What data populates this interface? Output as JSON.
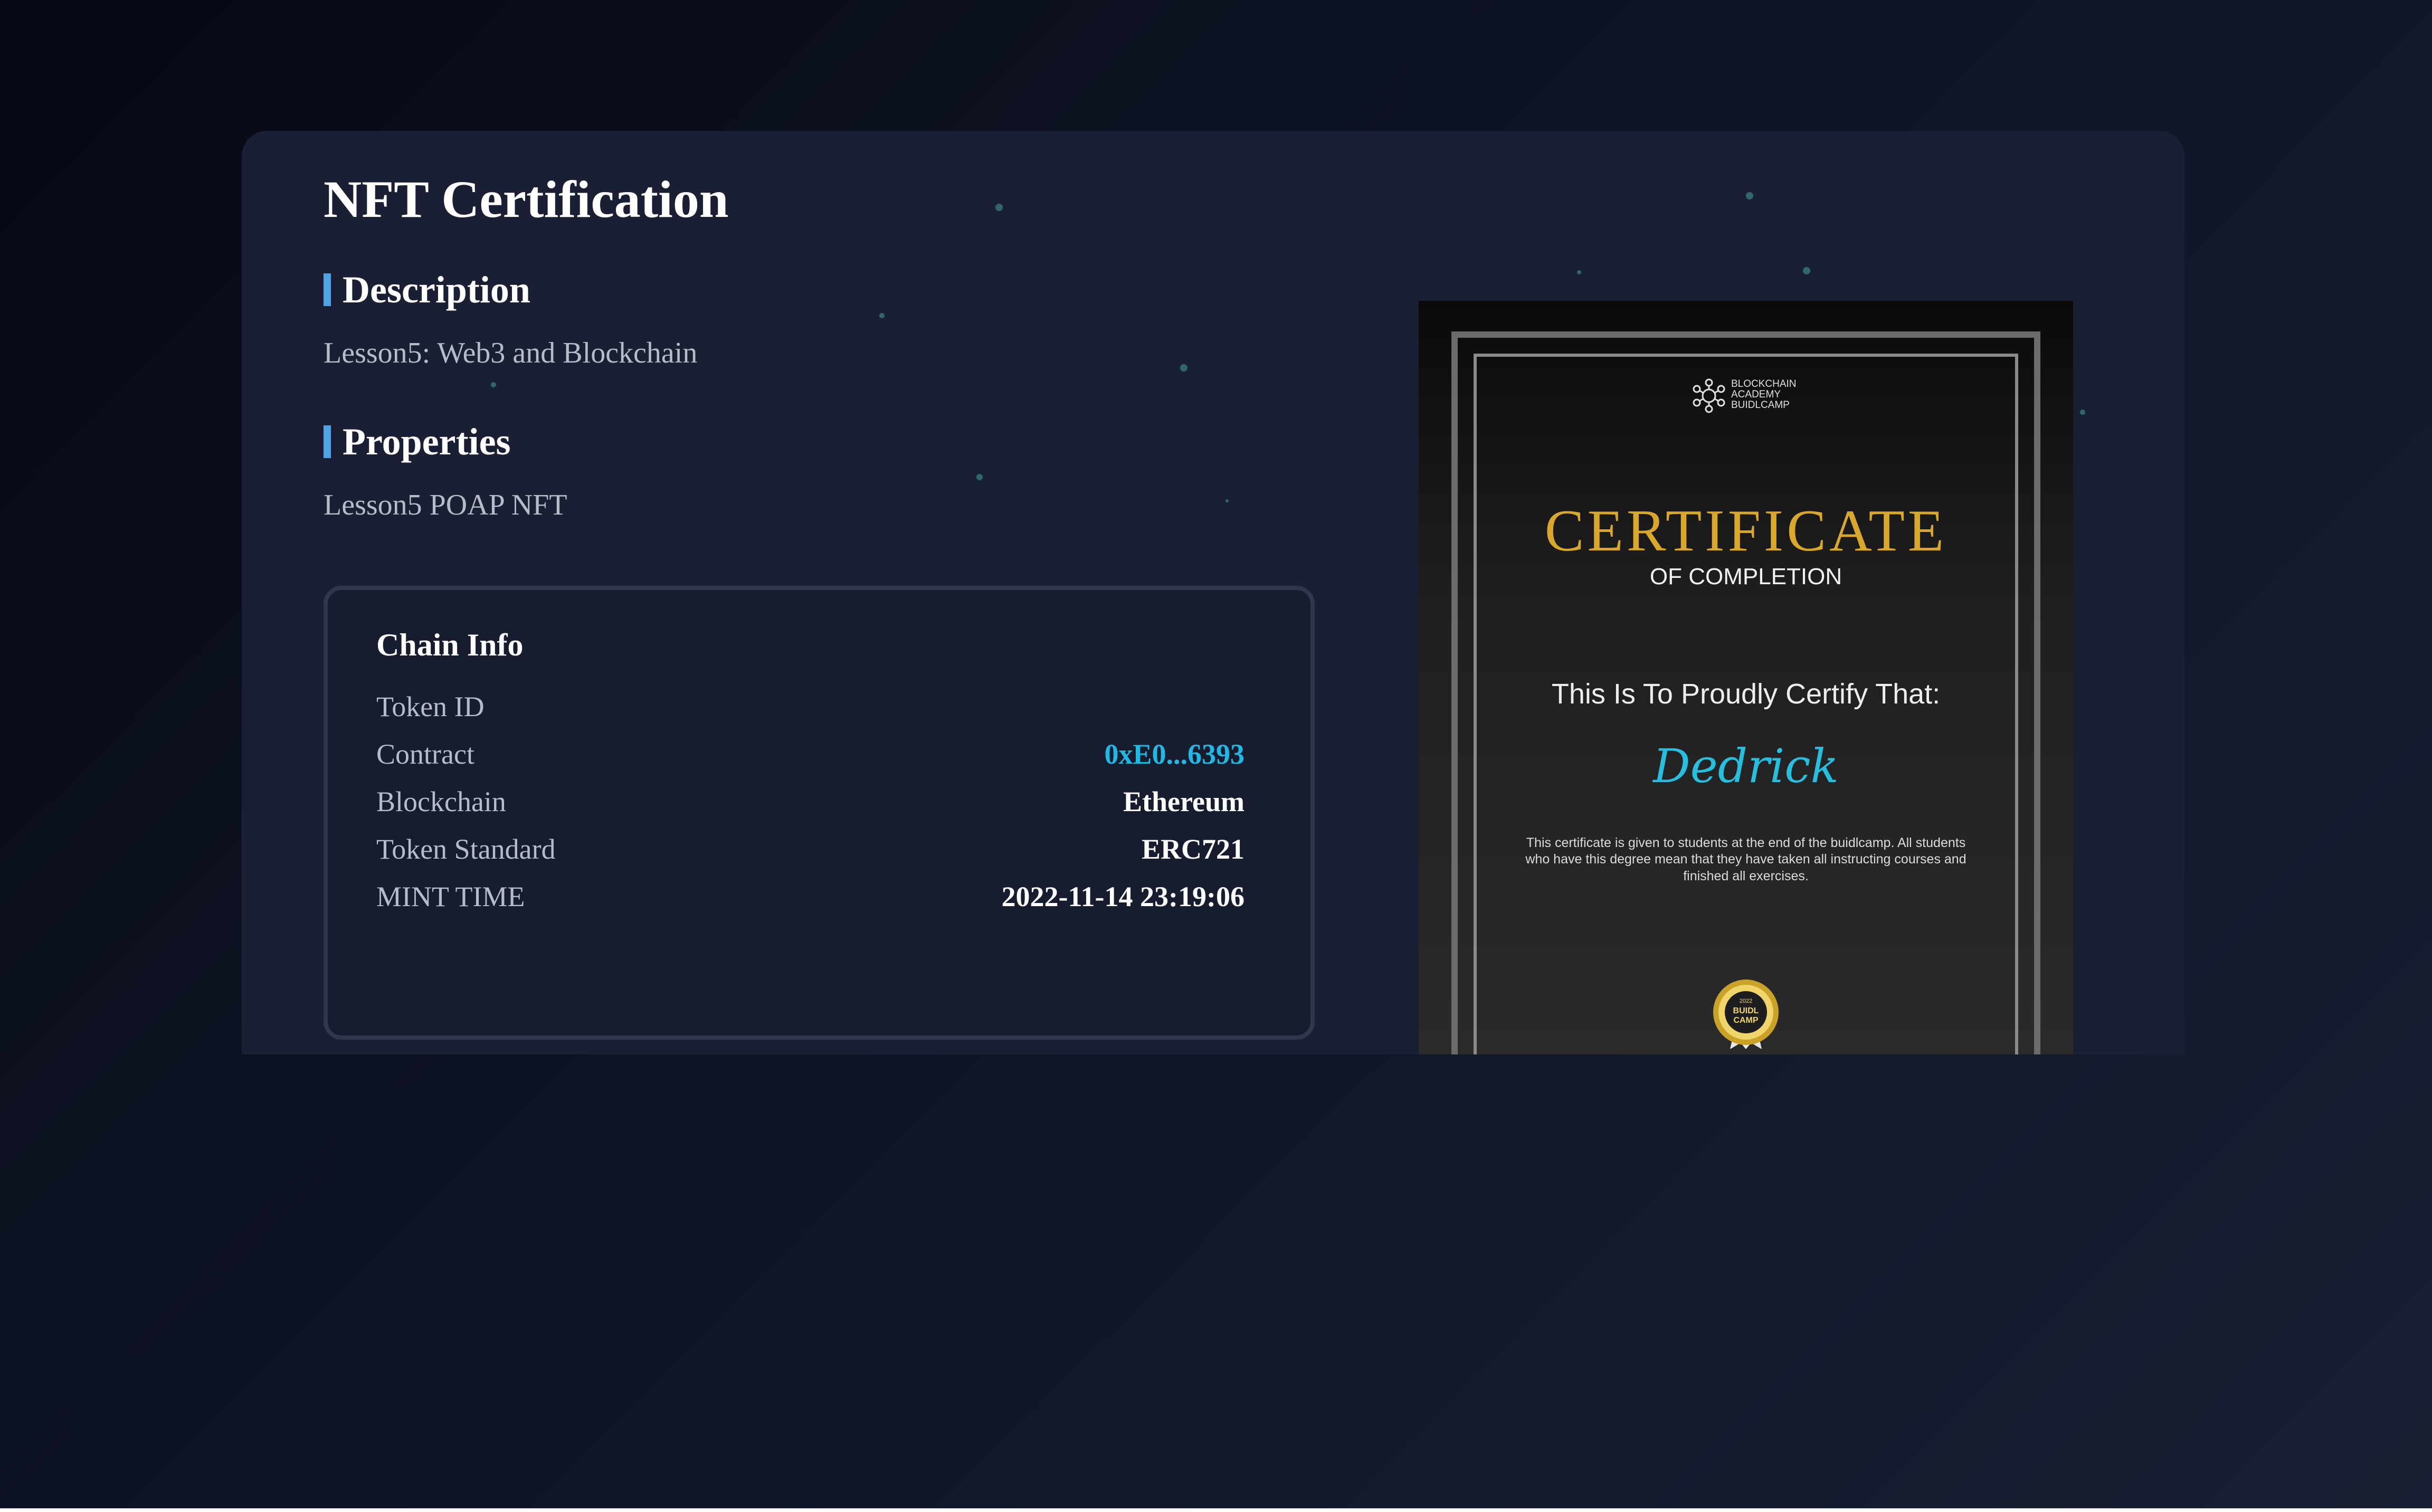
{
  "page": {
    "title": "NFT Certification"
  },
  "description": {
    "heading": "Description",
    "text": "Lesson5: Web3 and Blockchain"
  },
  "properties": {
    "heading": "Properties",
    "text": "Lesson5 POAP NFT"
  },
  "chain_info": {
    "title": "Chain Info",
    "rows": [
      {
        "label": "Token ID",
        "value": ""
      },
      {
        "label": "Contract",
        "value": "0xE0...6393"
      },
      {
        "label": "Blockchain",
        "value": "Ethereum"
      },
      {
        "label": "Token Standard",
        "value": "ERC721"
      },
      {
        "label": "MINT TIME",
        "value": "2022-11-14 23:19:06"
      }
    ]
  },
  "certificate": {
    "logo_text_line1": "BLOCKCHAIN",
    "logo_text_line2": "ACADEMY",
    "logo_text_line3": "BUIDLCAMP",
    "title": "CERTIFICATE",
    "subtitle": "OF COMPLETION",
    "certify_line": "This Is To Proudly Certify That:",
    "recipient": "Dedrick",
    "body": "This certificate is given to students at the end of the  buidlcamp. All students who have this degree mean that they have taken all instructing courses and finished all exercises.",
    "seal_text_top": "2022",
    "seal_text_middle": "BUIDL",
    "seal_text_bottom": "CAMP"
  },
  "colors": {
    "accent_bar": "#4ea2e6",
    "link": "#1fb9e6",
    "certificate_gold": "#d9a82a",
    "recipient_cyan": "#25bfe0"
  }
}
